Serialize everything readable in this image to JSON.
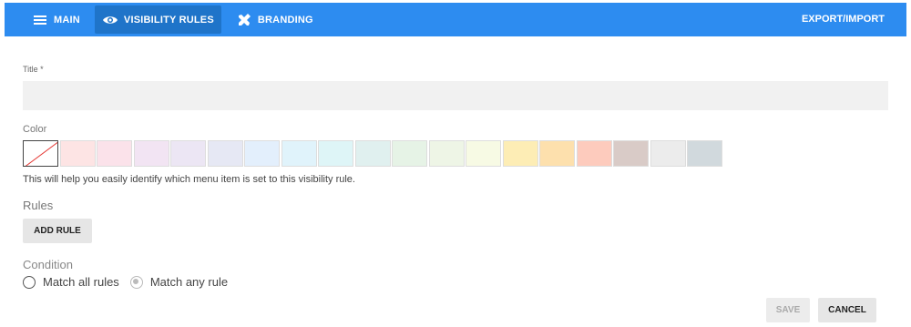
{
  "topbar": {
    "tabs": [
      {
        "label": "MAIN",
        "icon": "hamburger-icon"
      },
      {
        "label": "VISIBILITY RULES",
        "icon": "eye-icon"
      },
      {
        "label": "BRANDING",
        "icon": "tools-icon"
      }
    ],
    "export_label": "EXPORT/IMPORT",
    "bar_color": "#2d8cf0",
    "active_tab_color": "#1f74c9"
  },
  "form": {
    "title_label": "Title *",
    "title_value": "",
    "color_label": "Color",
    "swatches": [
      "none",
      "#fde4e4",
      "#fbe2ea",
      "#f2e4f3",
      "#ece6f4",
      "#e6e8f4",
      "#e3effc",
      "#e0f3fb",
      "#def5f7",
      "#e0f0ef",
      "#e6f3e6",
      "#eef5e6",
      "#f7fae4",
      "#fdedb5",
      "#fde0ad",
      "#fdcbbd",
      "#d9cbc7",
      "#ececec",
      "#d1d9dd"
    ],
    "color_helper": "This will help you easily identify which menu item is set to this visibility rule.",
    "rules_label": "Rules",
    "add_rule_label": "ADD RULE",
    "condition_label": "Condition",
    "condition_options": [
      {
        "label": "Match all rules",
        "checked": false
      },
      {
        "label": "Match any rule",
        "checked": true
      }
    ]
  },
  "actions": {
    "save_label": "SAVE",
    "cancel_label": "CANCEL"
  }
}
